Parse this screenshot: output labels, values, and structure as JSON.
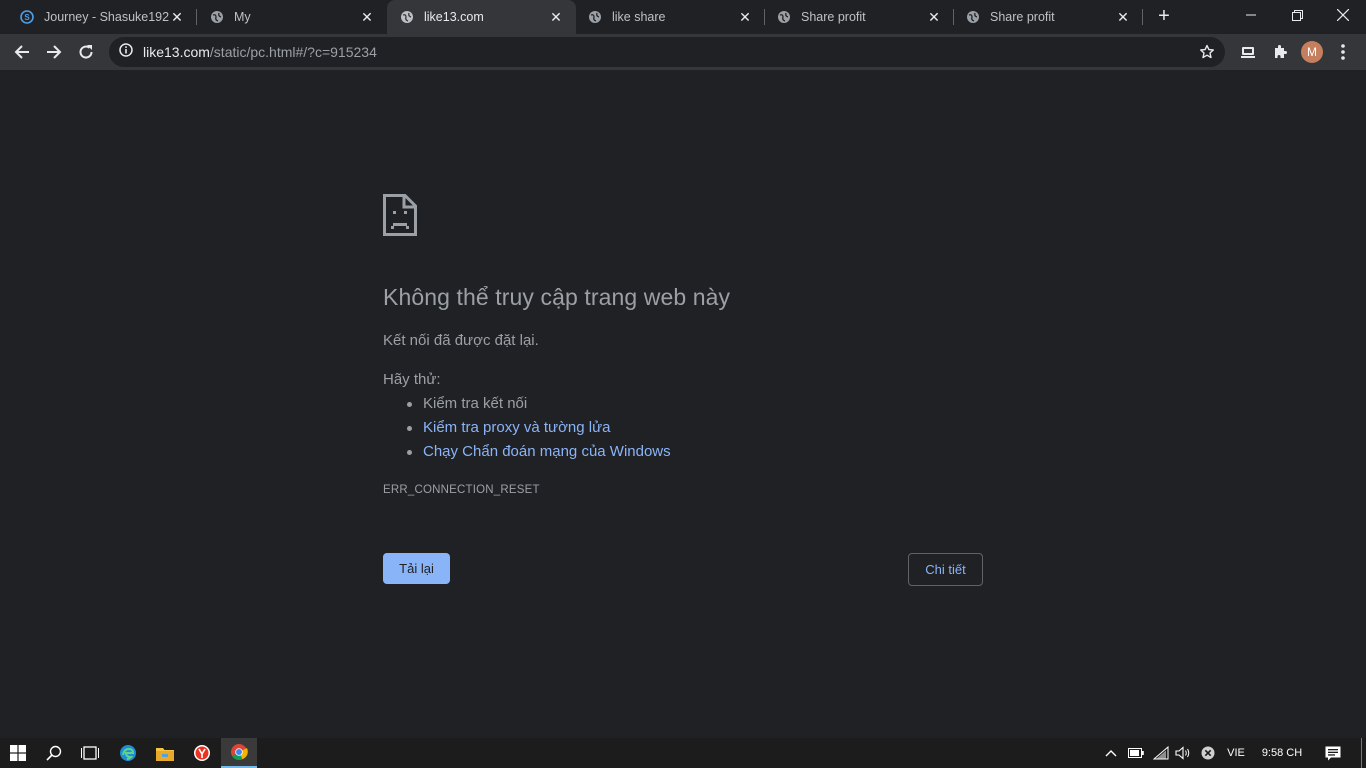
{
  "tabs": [
    {
      "title": "Journey - Shasuke192 -",
      "icon": "user-favicon-icon",
      "active": false
    },
    {
      "title": "My",
      "icon": "globe-icon",
      "active": false
    },
    {
      "title": "like13.com",
      "icon": "globe-icon",
      "active": true
    },
    {
      "title": "like share",
      "icon": "globe-icon",
      "active": false
    },
    {
      "title": "Share profit",
      "icon": "globe-icon",
      "active": false
    },
    {
      "title": "Share profit",
      "icon": "globe-icon",
      "active": false
    }
  ],
  "omnibox": {
    "host": "like13.com",
    "path": "/static/pc.html#/?c=915234"
  },
  "profile": {
    "initial": "M"
  },
  "error": {
    "icon": "sad-page-icon",
    "title": "Không thể truy cập trang web này",
    "description": "Kết nối đã được đặt lại.",
    "try_label": "Hãy thử:",
    "suggestions": [
      "Kiểm tra kết nối",
      "Kiểm tra proxy và tường lửa",
      "Chạy Chẩn đoán mạng của Windows"
    ],
    "code": "ERR_CONNECTION_RESET",
    "reload_label": "Tải lại",
    "details_label": "Chi tiết"
  },
  "taskbar": {
    "language": "VIE",
    "clock": "9:58 CH"
  },
  "colors": {
    "background": "#202124",
    "toolbar": "#35363a",
    "link": "#8ab4f8",
    "text_muted": "#9aa0a6"
  }
}
